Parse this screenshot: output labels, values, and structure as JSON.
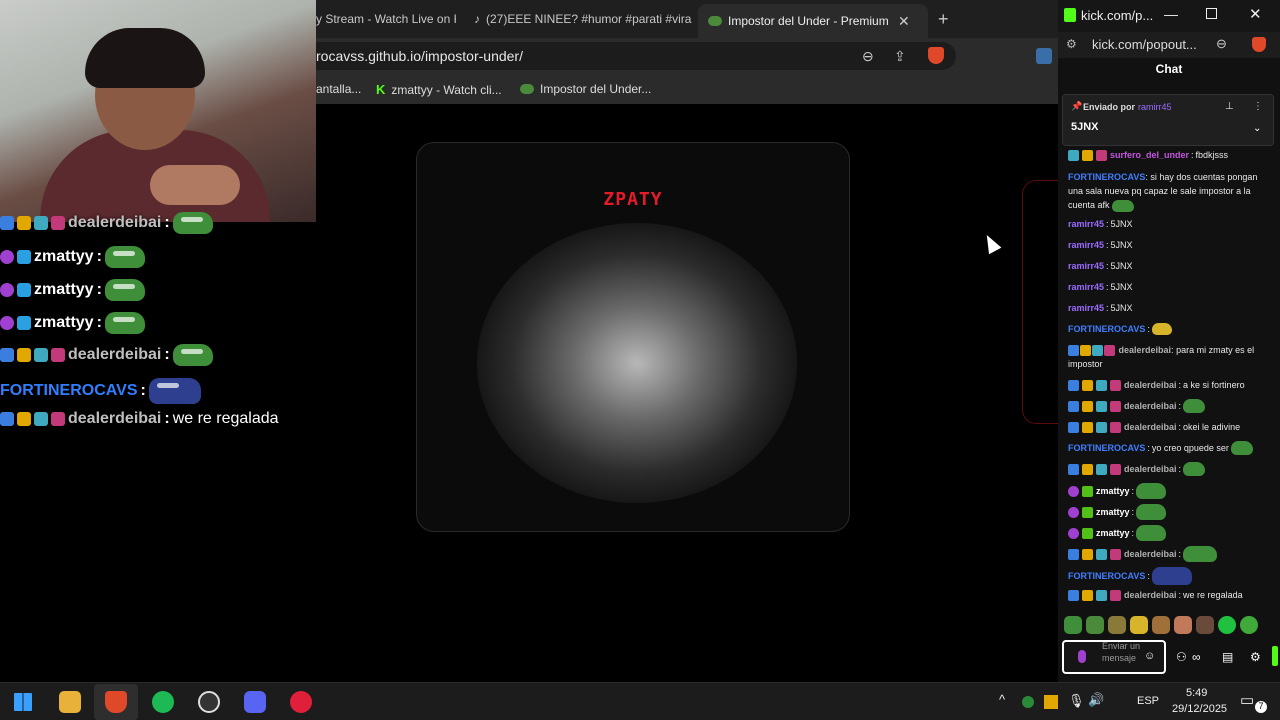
{
  "browser": {
    "tabs": [
      {
        "label": "y Stream - Watch Live on K"
      },
      {
        "label": "(27)EEE NINEE? #humor #parati #vira"
      },
      {
        "label": "Impostor del Under - Premium E"
      }
    ],
    "new_tab": "+",
    "url": "rocavss.github.io/impostor-under/",
    "bookmarks": [
      {
        "label": "antalla..."
      },
      {
        "label": "zmattyy - Watch cli..."
      },
      {
        "label": "Impostor del Under..."
      }
    ]
  },
  "page": {
    "card_title": "ZPATY"
  },
  "overlay_chat": [
    {
      "user": "dealerdeibai",
      "color": "#bfbfbf",
      "text": "",
      "emote": true
    },
    {
      "user": "zmattyy",
      "color": "#ffffff",
      "text": "",
      "emote": true
    },
    {
      "user": "zmattyy",
      "color": "#ffffff",
      "text": "",
      "emote": true
    },
    {
      "user": "zmattyy",
      "color": "#ffffff",
      "text": "",
      "emote": true
    },
    {
      "user": "dealerdeibai",
      "color": "#bfbfbf",
      "text": "",
      "emote": true
    },
    {
      "user": "FORTINEROCAVS",
      "color": "#2f7fff",
      "text": "",
      "emote": true
    },
    {
      "user": "dealerdeibai",
      "color": "#bfbfbf",
      "text": "we re regalada",
      "emote": false
    }
  ],
  "kick": {
    "window_title": "kick.com/p...",
    "address": "kick.com/popout...",
    "chat_header": "Chat",
    "pinned_by_label": "Enviado por",
    "pinned_by_user": "ramirr45",
    "pinned_text": "5JNX",
    "messages": [
      {
        "user": "surfero_del_under",
        "color": "#c455e0",
        "text": "fbdkjsss"
      },
      {
        "user": "FORTINEROCAVS",
        "color": "#3f7fff",
        "text": "si hay dos cuentas pongan una sala nueva pq capaz le sale impostor a la cuenta afk"
      },
      {
        "user": "ramirr45",
        "color": "#9a6bff",
        "text": "5JNX"
      },
      {
        "user": "ramirr45",
        "color": "#9a6bff",
        "text": "5JNX"
      },
      {
        "user": "ramirr45",
        "color": "#9a6bff",
        "text": "5JNX"
      },
      {
        "user": "ramirr45",
        "color": "#9a6bff",
        "text": "5JNX"
      },
      {
        "user": "ramirr45",
        "color": "#9a6bff",
        "text": "5JNX"
      },
      {
        "user": "FORTINEROCAVS",
        "color": "#3f7fff",
        "text": ""
      },
      {
        "user": "dealerdeibai",
        "color": "#b0b0b0",
        "text": "para mi zmaty es el impostor"
      },
      {
        "user": "dealerdeibai",
        "color": "#b0b0b0",
        "text": "a ke si fortinero"
      },
      {
        "user": "dealerdeibai",
        "color": "#b0b0b0",
        "text": ""
      },
      {
        "user": "dealerdeibai",
        "color": "#b0b0b0",
        "text": "okei le adivine"
      },
      {
        "user": "FORTINEROCAVS",
        "color": "#3f7fff",
        "text": "yo creo qpuede ser"
      },
      {
        "user": "dealerdeibai",
        "color": "#b0b0b0",
        "text": ""
      },
      {
        "user": "zmattyy",
        "color": "#ffffff",
        "text": ""
      },
      {
        "user": "zmattyy",
        "color": "#ffffff",
        "text": ""
      },
      {
        "user": "zmattyy",
        "color": "#ffffff",
        "text": ""
      },
      {
        "user": "dealerdeibai",
        "color": "#b0b0b0",
        "text": ""
      },
      {
        "user": "FORTINEROCAVS",
        "color": "#3f7fff",
        "text": ""
      },
      {
        "user": "dealerdeibai",
        "color": "#b0b0b0",
        "text": "we re regalada"
      }
    ],
    "input_placeholder": "Enviar un mensaje"
  },
  "taskbar": {
    "language": "ESP",
    "time": "5:49",
    "date": "29/12/2025",
    "notifications": "7"
  }
}
